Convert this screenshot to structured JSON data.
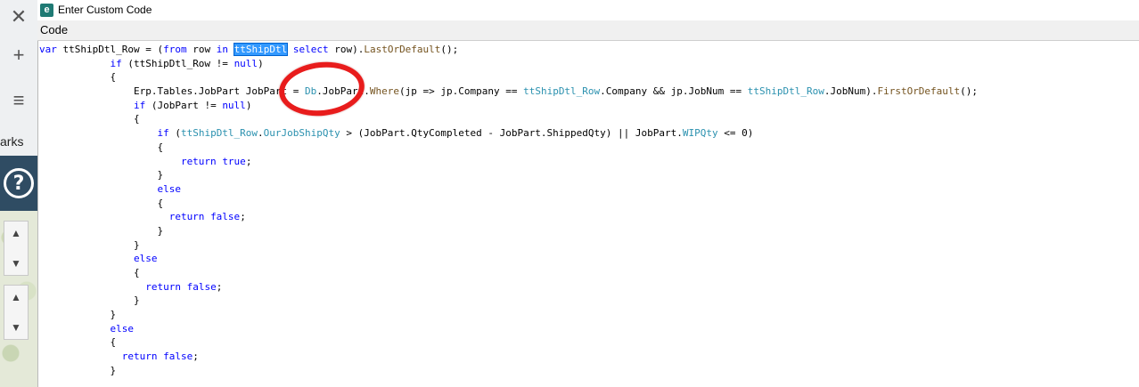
{
  "window": {
    "title": "Enter Custom Code",
    "app_icon": "epicor-icon"
  },
  "tabbar": {
    "label": "Code"
  },
  "left_strip": {
    "close_glyph": "✕",
    "add_glyph": "+",
    "menu_glyph": "≡",
    "partial_text": "arks",
    "help_glyph": "?",
    "up_glyph": "▲",
    "down_glyph": "▼"
  },
  "code": {
    "lines": [
      [
        {
          "t": "var ",
          "c": "kw"
        },
        {
          "t": "ttShipDtl_Row = (",
          "c": ""
        },
        {
          "t": "from",
          "c": "kw"
        },
        {
          "t": " row ",
          "c": ""
        },
        {
          "t": "in",
          "c": "kw"
        },
        {
          "t": " ",
          "c": ""
        },
        {
          "t": "ttShipDtl",
          "c": "sel"
        },
        {
          "t": " ",
          "c": ""
        },
        {
          "t": "select",
          "c": "kw"
        },
        {
          "t": " row).",
          "c": ""
        },
        {
          "t": "LastOrDefault",
          "c": "mt"
        },
        {
          "t": "();",
          "c": ""
        }
      ],
      [
        {
          "t": "            if",
          "c": "kw"
        },
        {
          "t": " (ttShipDtl_Row != ",
          "c": ""
        },
        {
          "t": "null",
          "c": "kw"
        },
        {
          "t": ")",
          "c": ""
        }
      ],
      [
        {
          "t": "            {",
          "c": ""
        }
      ],
      [
        {
          "t": "                Erp.Tables.JobPart JobPart = ",
          "c": ""
        },
        {
          "t": "Db",
          "c": "ty"
        },
        {
          "t": ".JobPart.",
          "c": ""
        },
        {
          "t": "Where",
          "c": "mt"
        },
        {
          "t": "(jp => jp.Company == ",
          "c": ""
        },
        {
          "t": "ttShipDtl_Row",
          "c": "ty"
        },
        {
          "t": ".Company && jp.JobNum == ",
          "c": ""
        },
        {
          "t": "ttShipDtl_Row",
          "c": "ty"
        },
        {
          "t": ".JobNum).",
          "c": ""
        },
        {
          "t": "FirstOrDefault",
          "c": "mt"
        },
        {
          "t": "();",
          "c": ""
        }
      ],
      [
        {
          "t": "                if",
          "c": "kw"
        },
        {
          "t": " (JobPart != ",
          "c": ""
        },
        {
          "t": "null",
          "c": "kw"
        },
        {
          "t": ")",
          "c": ""
        }
      ],
      [
        {
          "t": "                {",
          "c": ""
        }
      ],
      [
        {
          "t": "                    if",
          "c": "kw"
        },
        {
          "t": " (",
          "c": ""
        },
        {
          "t": "ttShipDtl_Row",
          "c": "ty"
        },
        {
          "t": ".",
          "c": ""
        },
        {
          "t": "OurJobShipQty",
          "c": "ty"
        },
        {
          "t": " > (JobPart.QtyCompleted - JobPart.ShippedQty) || JobPart.",
          "c": ""
        },
        {
          "t": "WIPQty",
          "c": "ty"
        },
        {
          "t": " <= 0)",
          "c": ""
        }
      ],
      [
        {
          "t": "                    {",
          "c": ""
        }
      ],
      [
        {
          "t": "                        return",
          "c": "kw"
        },
        {
          "t": " ",
          "c": ""
        },
        {
          "t": "true",
          "c": "kw"
        },
        {
          "t": ";",
          "c": ""
        }
      ],
      [
        {
          "t": "                    }",
          "c": ""
        }
      ],
      [
        {
          "t": "                    else",
          "c": "kw"
        }
      ],
      [
        {
          "t": "                    {",
          "c": ""
        }
      ],
      [
        {
          "t": "                      return",
          "c": "kw"
        },
        {
          "t": " ",
          "c": ""
        },
        {
          "t": "false",
          "c": "kw"
        },
        {
          "t": ";",
          "c": ""
        }
      ],
      [
        {
          "t": "                    }",
          "c": ""
        }
      ],
      [
        {
          "t": "                }",
          "c": ""
        }
      ],
      [
        {
          "t": "                else",
          "c": "kw"
        }
      ],
      [
        {
          "t": "                {",
          "c": ""
        }
      ],
      [
        {
          "t": "                  return",
          "c": "kw"
        },
        {
          "t": " ",
          "c": ""
        },
        {
          "t": "false",
          "c": "kw"
        },
        {
          "t": ";",
          "c": ""
        }
      ],
      [
        {
          "t": "                }",
          "c": ""
        }
      ],
      [
        {
          "t": "            }",
          "c": ""
        }
      ],
      [
        {
          "t": "            else",
          "c": "kw"
        }
      ],
      [
        {
          "t": "            {",
          "c": ""
        }
      ],
      [
        {
          "t": "              return",
          "c": "kw"
        },
        {
          "t": " ",
          "c": ""
        },
        {
          "t": "false",
          "c": "kw"
        },
        {
          "t": ";",
          "c": ""
        }
      ],
      [
        {
          "t": "            }",
          "c": ""
        }
      ]
    ]
  },
  "annotation": {
    "shape": "red-ellipse",
    "color": "#e81c1c"
  }
}
